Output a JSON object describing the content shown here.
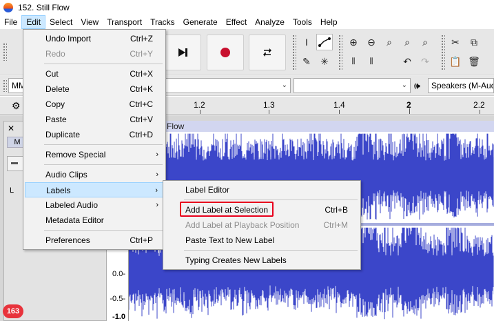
{
  "window": {
    "title": "152. Still Flow"
  },
  "menubar": [
    "File",
    "Edit",
    "Select",
    "View",
    "Transport",
    "Tracks",
    "Generate",
    "Effect",
    "Analyze",
    "Tools",
    "Help"
  ],
  "device_toolbar": {
    "host": "MM",
    "output_device": "Speakers (M-Audi"
  },
  "ruler": {
    "ticks": [
      "1.2",
      "1.3",
      "1.4",
      "2",
      "2.2"
    ]
  },
  "track": {
    "name": "Flow",
    "ctrl_m": "M",
    "ctrl_l": "L",
    "scale": [
      "0.0-",
      "-0.5-",
      "-1.0"
    ]
  },
  "edit_menu": {
    "items": [
      {
        "label": "Undo Import",
        "shortcut": "Ctrl+Z",
        "disabled": false
      },
      {
        "label": "Redo",
        "shortcut": "Ctrl+Y",
        "disabled": true
      },
      {
        "label": "Cut",
        "shortcut": "Ctrl+X",
        "disabled": false
      },
      {
        "label": "Delete",
        "shortcut": "Ctrl+K",
        "disabled": false
      },
      {
        "label": "Copy",
        "shortcut": "Ctrl+C",
        "disabled": false
      },
      {
        "label": "Paste",
        "shortcut": "Ctrl+V",
        "disabled": false
      },
      {
        "label": "Duplicate",
        "shortcut": "Ctrl+D",
        "disabled": false
      },
      {
        "label": "Remove Special",
        "shortcut": "",
        "submenu": true
      },
      {
        "label": "Audio Clips",
        "shortcut": "",
        "submenu": true
      },
      {
        "label": "Labels",
        "shortcut": "",
        "submenu": true,
        "highlighted": true
      },
      {
        "label": "Labeled Audio",
        "shortcut": "",
        "submenu": true
      },
      {
        "label": "Metadata Editor",
        "shortcut": ""
      },
      {
        "label": "Preferences",
        "shortcut": "Ctrl+P"
      }
    ]
  },
  "labels_menu": {
    "items": [
      {
        "label": "Label Editor",
        "shortcut": ""
      },
      {
        "label": "Add Label at Selection",
        "shortcut": "Ctrl+B"
      },
      {
        "label": "Add Label at Playback Position",
        "shortcut": "Ctrl+M",
        "disabled": true
      },
      {
        "label": "Paste Text to New Label",
        "shortcut": ""
      },
      {
        "label": "Typing Creates New Labels",
        "shortcut": ""
      }
    ]
  },
  "badge": {
    "count": "163"
  },
  "colors": {
    "accent": "#cce8ff",
    "waveform": "#3b46c9",
    "highlight_box": "#e8001c"
  }
}
